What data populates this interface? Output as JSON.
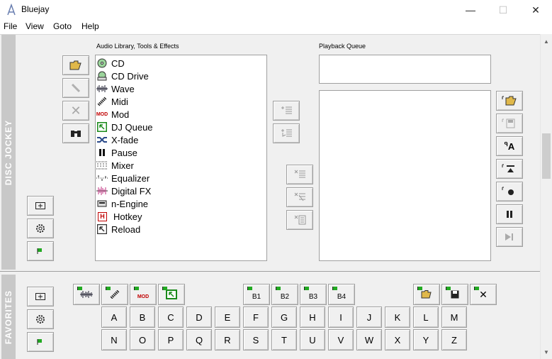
{
  "window": {
    "title": "Bluejay",
    "controls": {
      "minimize": "—",
      "maximize": "☐",
      "close": "✕"
    }
  },
  "menu": [
    "File",
    "View",
    "Goto",
    "Help"
  ],
  "disc_jockey": {
    "tab_label": "DISC JOCKEY",
    "library_label": "Audio Library, Tools & Effects",
    "queue_label": "Playback Queue",
    "library_items": [
      {
        "label": "CD",
        "icon": "cd-icon"
      },
      {
        "label": "CD Drive",
        "icon": "cd-drive-icon"
      },
      {
        "label": "Wave",
        "icon": "wave-icon"
      },
      {
        "label": "Midi",
        "icon": "midi-icon"
      },
      {
        "label": "Mod",
        "icon": "mod-icon"
      },
      {
        "label": "DJ Queue",
        "icon": "dj-queue-icon"
      },
      {
        "label": "X-fade",
        "icon": "xfade-icon"
      },
      {
        "label": "Pause",
        "icon": "pause-icon"
      },
      {
        "label": "Mixer",
        "icon": "mixer-icon"
      },
      {
        "label": "Equalizer",
        "icon": "equalizer-icon"
      },
      {
        "label": "Digital FX",
        "icon": "digital-fx-icon"
      },
      {
        "label": "n-Engine",
        "icon": "n-engine-icon"
      },
      {
        "label": "Hotkey",
        "icon": "hotkey-icon"
      },
      {
        "label": "Reload",
        "icon": "reload-icon"
      }
    ],
    "mod_icon_text": "MOD",
    "hotkey_icon_text": "H"
  },
  "favorites": {
    "tab_label": "FAVORITES",
    "bank_buttons": [
      "B1",
      "B2",
      "B3",
      "B4"
    ],
    "mod_text": "MOD",
    "keys_row1": [
      "A",
      "B",
      "C",
      "D",
      "E",
      "F",
      "G",
      "H",
      "I",
      "J",
      "K",
      "L",
      "M"
    ],
    "keys_row2": [
      "N",
      "O",
      "P",
      "Q",
      "R",
      "S",
      "T",
      "U",
      "V",
      "W",
      "X",
      "Y",
      "Z"
    ]
  },
  "icons": {
    "queue_controls": [
      "load-playlist-icon",
      "save-playlist-icon",
      "rename-icon",
      "eject-icon",
      "record-icon",
      "pause-icon",
      "skip-icon"
    ],
    "queue_control_glyphs": [
      "📂",
      "💾",
      "A",
      "⏏",
      "●",
      "❚❚",
      "▶❚"
    ]
  },
  "colors": {
    "flag": "#22aa22",
    "mod": "#c00000",
    "dj_queue": "#1a8a1a",
    "tab": "#c8c8c8"
  }
}
